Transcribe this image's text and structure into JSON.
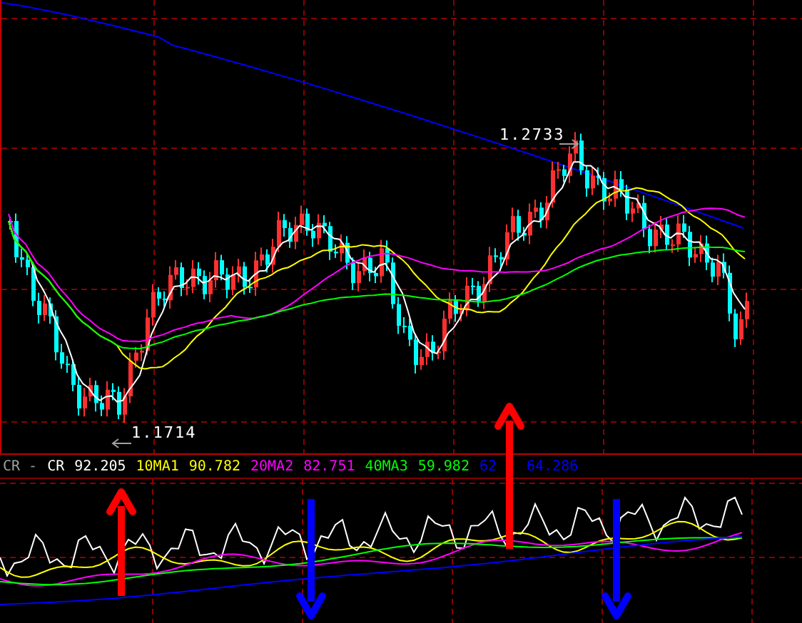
{
  "main_chart": {
    "high_label": "1.2733",
    "low_label": "1.1714"
  },
  "indicator": {
    "legend": [
      {
        "label": "CR -",
        "color": "#a0a0a0"
      },
      {
        "label": "CR",
        "value": "92.205",
        "color": "#ffffff"
      },
      {
        "label": "10MA1",
        "value": "90.782",
        "color": "#ffff00"
      },
      {
        "label": "20MA2",
        "value": "82.751",
        "color": "#ff00ff"
      },
      {
        "label": "40MA3",
        "value": "59.982",
        "color": "#00ff00"
      },
      {
        "label": "62",
        "color": "#0000ff"
      },
      {
        "value": "64.286",
        "color": "#0000ff"
      }
    ]
  },
  "arrows": [
    {
      "kind": "up",
      "color": "#ff0000"
    },
    {
      "kind": "down",
      "color": "#0000ff"
    },
    {
      "kind": "up",
      "color": "#ff0000"
    },
    {
      "kind": "down",
      "color": "#0000ff"
    }
  ]
}
